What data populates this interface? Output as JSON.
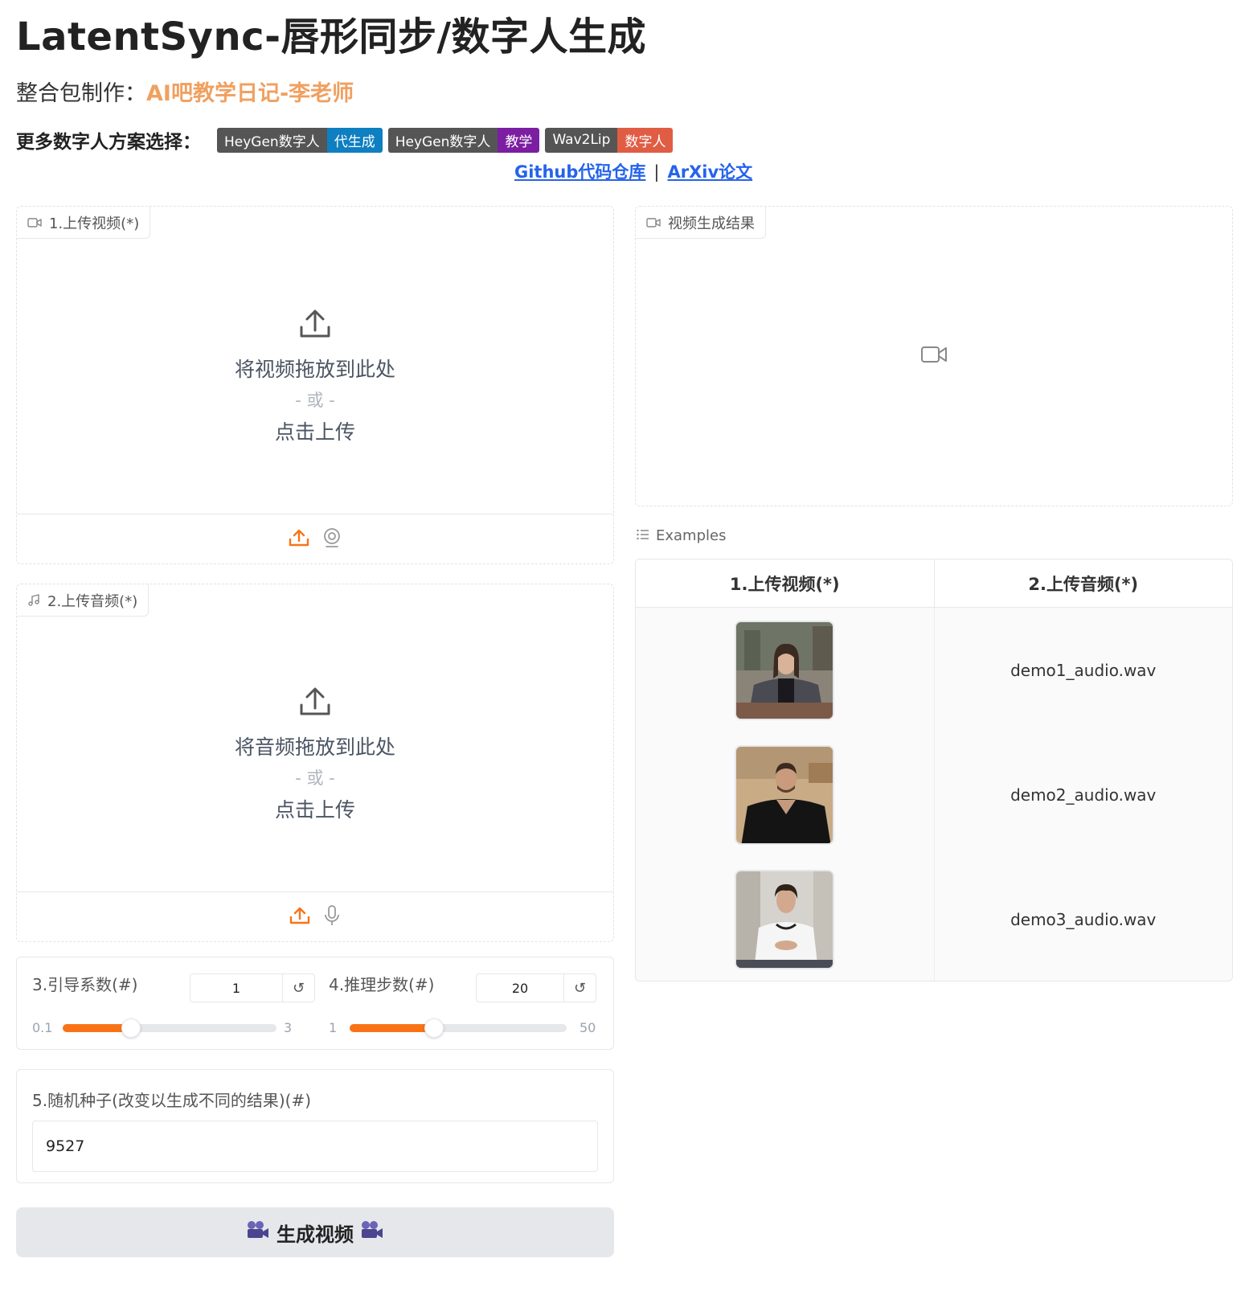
{
  "header": {
    "title": "LatentSync-唇形同步/数字人生成",
    "subtitle_prefix": "整合包制作：",
    "subtitle_author": "AI吧教学日记-李老师",
    "more_label": "更多数字人方案选择：",
    "badges": [
      {
        "left": "HeyGen数字人",
        "right": "代生成"
      },
      {
        "left": "HeyGen数字人",
        "right": "教学"
      },
      {
        "left": "Wav2Lip",
        "right": "数字人"
      }
    ],
    "links": {
      "github": "Github代码仓库",
      "sep": "|",
      "arxiv": "ArXiv论文"
    }
  },
  "video_upload": {
    "label": "1.上传视频(*)",
    "drop_text": "将视频拖放到此处",
    "or_text": "- 或 -",
    "click_text": "点击上传"
  },
  "audio_upload": {
    "label": "2.上传音频(*)",
    "drop_text": "将音频拖放到此处",
    "or_text": "- 或 -",
    "click_text": "点击上传"
  },
  "guidance": {
    "label": "3.引导系数(#)",
    "value": "1",
    "min": "0.1",
    "max": "3",
    "fraction": 0.32
  },
  "steps": {
    "label": "4.推理步数(#)",
    "value": "20",
    "min": "1",
    "max": "50",
    "fraction": 0.39
  },
  "seed": {
    "label": "5.随机种子(改变以生成不同的结果)(#)",
    "value": "9527"
  },
  "generate": {
    "label": "生成视频"
  },
  "output": {
    "label": "视频生成结果"
  },
  "examples": {
    "label": "Examples",
    "headers": [
      "1.上传视频(*)",
      "2.上传音频(*)"
    ],
    "rows": [
      {
        "audio": "demo1_audio.wav"
      },
      {
        "audio": "demo2_audio.wav"
      },
      {
        "audio": "demo3_audio.wav"
      }
    ]
  },
  "colors": {
    "accent": "#f97316",
    "author": "#f0a060",
    "link": "#2563eb",
    "badge_dark": "#555555",
    "badge_blue": "#0e7fc0",
    "badge_purple": "#7b1ea2",
    "badge_red": "#e05d44"
  }
}
